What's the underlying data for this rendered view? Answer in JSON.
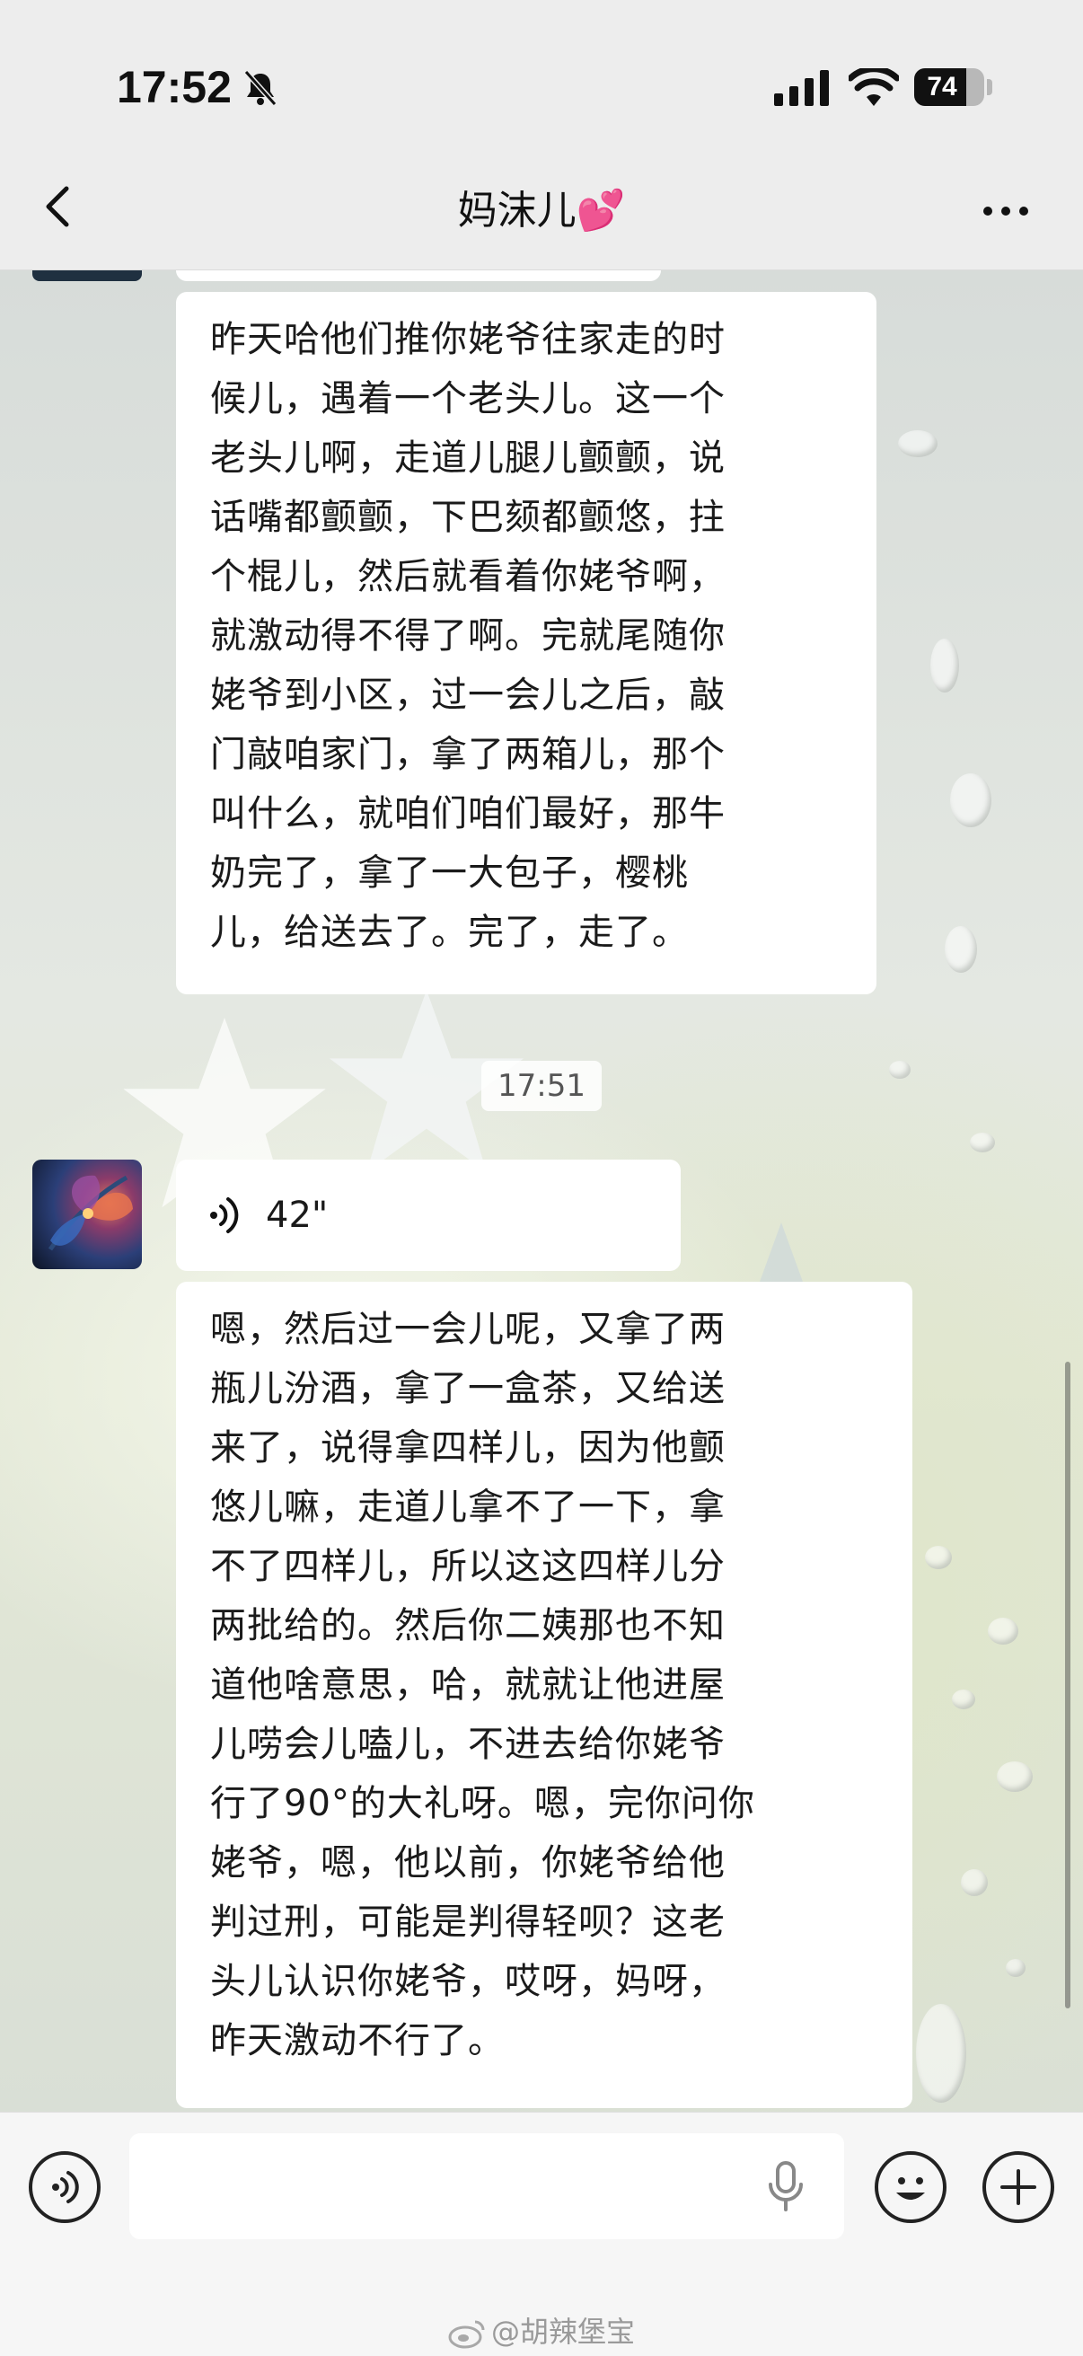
{
  "status_bar": {
    "time": "17:52",
    "battery": "74",
    "battery_level": 0.74,
    "icons": [
      "bell-slash-icon",
      "cellular-signal-icon",
      "wifi-icon",
      "battery-icon"
    ]
  },
  "nav": {
    "title": "妈沫儿💕",
    "back_icon": "chevron-left-icon",
    "more_icon": "ellipsis-icon"
  },
  "messages": [
    {
      "type": "text",
      "text": "昨天哈他们推你姥爷往家走的时\n候儿，遇着一个老头儿。这一个\n老头儿啊，走道儿腿儿颤颤，说\n话嘴都颤颤，下巴颏都颤悠，拄\n个棍儿，然后就看着你姥爷啊，\n就激动得不得了啊。完就尾随你\n姥爷到小区，过一会儿之后，敲\n门敲咱家门，拿了两箱儿，那个\n叫什么，就咱们咱们最好，那牛\n奶完了，拿了一大包子，樱桃\n儿，给送去了。完了，走了。"
    },
    {
      "type": "timestamp",
      "text": "17:51"
    },
    {
      "type": "voice",
      "duration": "42\""
    },
    {
      "type": "text",
      "text": "嗯，然后过一会儿呢，又拿了两\n瓶儿汾酒，拿了一盒茶，又给送\n来了，说得拿四样儿，因为他颤\n悠儿嘛，走道儿拿不了一下，拿\n不了四样儿，所以这这四样儿分\n两批给的。然后你二姨那也不知\n道他啥意思，哈，就就让他进屋\n儿唠会儿嗑儿，不进去给你姥爷\n行了90°的大礼呀。嗯，完你问你\n姥爷，嗯，他以前，你姥爷给他\n判过刑，可能是判得轻呗？这老\n头儿认识你姥爷，哎呀，妈呀，\n昨天激动不行了。"
    }
  ],
  "input_bar": {
    "icons": [
      "voice-mode-icon",
      "microphone-icon",
      "emoji-icon",
      "plus-icon"
    ]
  },
  "watermark": "@胡辣堡宝"
}
